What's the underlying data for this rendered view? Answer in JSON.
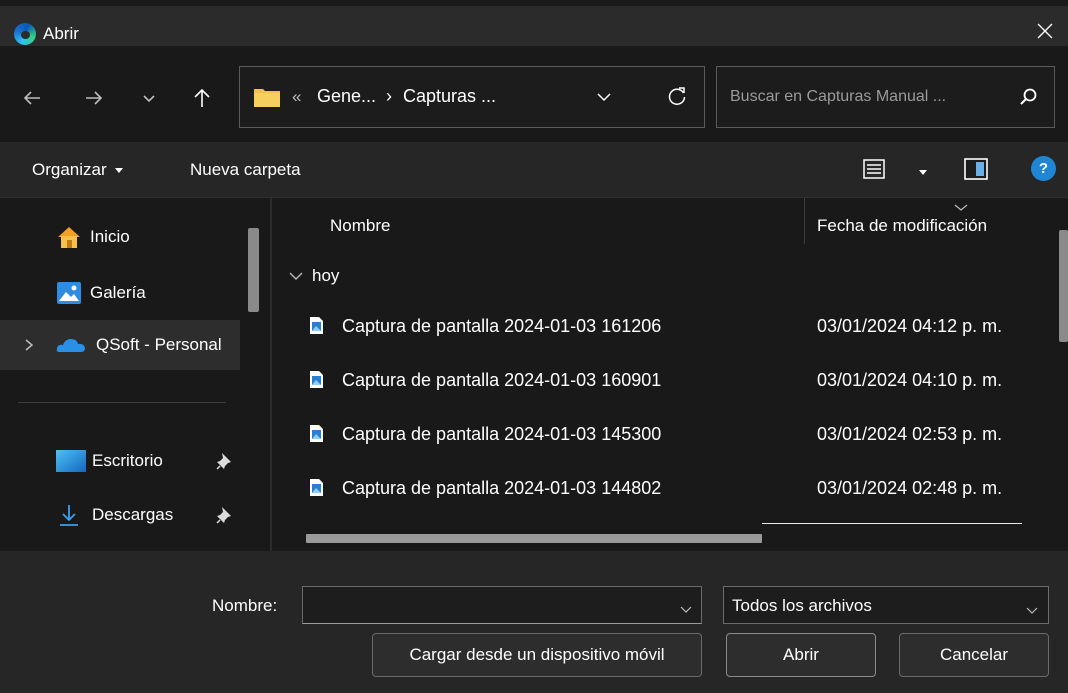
{
  "window": {
    "title": "Abrir"
  },
  "nav": {
    "address": {
      "separator": "«",
      "crumb1": "Gene...",
      "arrow": "›",
      "crumb2": "Capturas ..."
    },
    "search": {
      "placeholder": "Buscar en Capturas Manual ..."
    }
  },
  "toolbar": {
    "organize_label": "Organizar",
    "new_folder_label": "Nueva carpeta",
    "help_label": "?"
  },
  "sidebar": {
    "items": [
      {
        "label": "Inicio",
        "icon": "home-icon"
      },
      {
        "label": "Galería",
        "icon": "gallery-icon"
      },
      {
        "label": "QSoft - Personal",
        "icon": "onedrive-icon",
        "selected": true
      },
      {
        "label": "Escritorio",
        "icon": "desktop-icon",
        "pinned": true
      },
      {
        "label": "Descargas",
        "icon": "download-icon",
        "pinned": true
      }
    ]
  },
  "file_list": {
    "columns": {
      "name": "Nombre",
      "date": "Fecha de modificación"
    },
    "group_label": "hoy",
    "files": [
      {
        "name": "Captura de pantalla 2024-01-03 161206",
        "date": "03/01/2024 04:12 p. m."
      },
      {
        "name": "Captura de pantalla 2024-01-03 160901",
        "date": "03/01/2024 04:10 p. m."
      },
      {
        "name": "Captura de pantalla 2024-01-03 145300",
        "date": "03/01/2024 02:53 p. m."
      },
      {
        "name": "Captura de pantalla 2024-01-03 144802",
        "date": "03/01/2024 02:48 p. m."
      }
    ]
  },
  "footer": {
    "filename_label": "Nombre:",
    "filename_value": "",
    "filetype_value": "Todos los archivos",
    "mobile_button": "Cargar desde un dispositivo móvil",
    "open_button": "Abrir",
    "cancel_button": "Cancelar"
  },
  "colors": {
    "background": "#191919",
    "toolbar": "#262626",
    "accent": "#1f86d6",
    "folder": "#f2c14a"
  }
}
